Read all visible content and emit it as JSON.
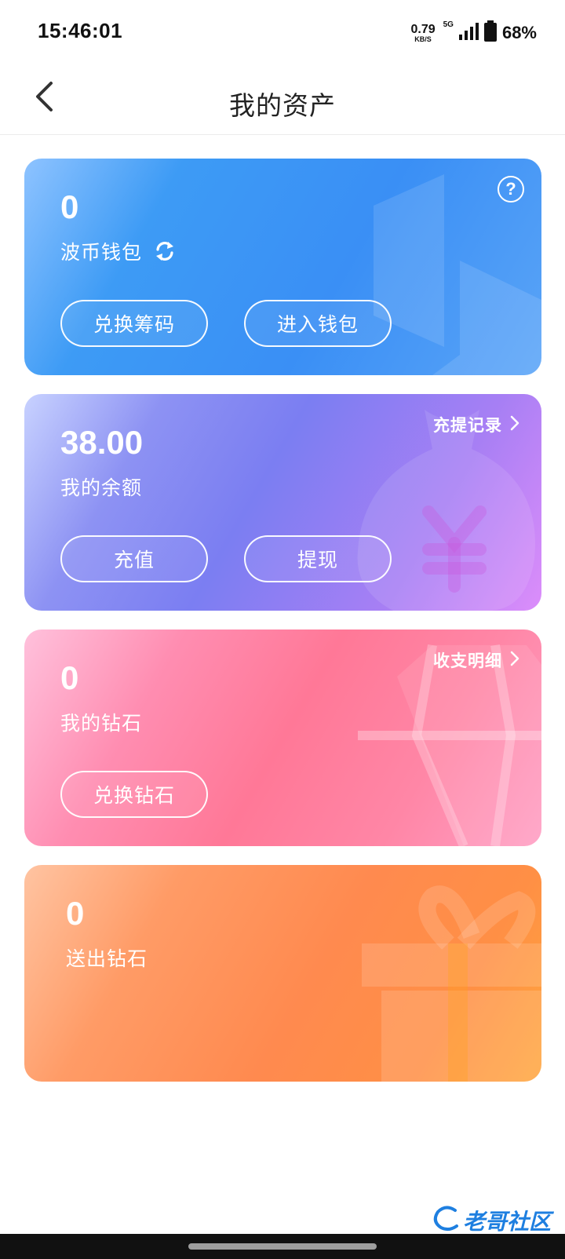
{
  "status_bar": {
    "time": "15:46:01",
    "net_speed_value": "0.79",
    "net_speed_unit": "KB/S",
    "network": "5G",
    "battery": "68%"
  },
  "header": {
    "title": "我的资产",
    "back_icon": "chevron-left-icon"
  },
  "cards": {
    "wallet": {
      "value": "0",
      "label": "波币钱包",
      "buttons": [
        "兑换筹码",
        "进入钱包"
      ],
      "color": "#3a8ff5"
    },
    "balance": {
      "value": "38.00",
      "label": "我的余额",
      "link": "充提记录",
      "buttons": [
        "充值",
        "提现"
      ],
      "color": "#7b7ef2"
    },
    "diamond": {
      "value": "0",
      "label": "我的钻石",
      "link": "收支明细",
      "buttons": [
        "兑换钻石"
      ],
      "color": "#ff7897"
    },
    "sent": {
      "value": "0",
      "label": "送出钻石",
      "color": "#ff8a4f"
    }
  },
  "watermark": "老哥社区"
}
